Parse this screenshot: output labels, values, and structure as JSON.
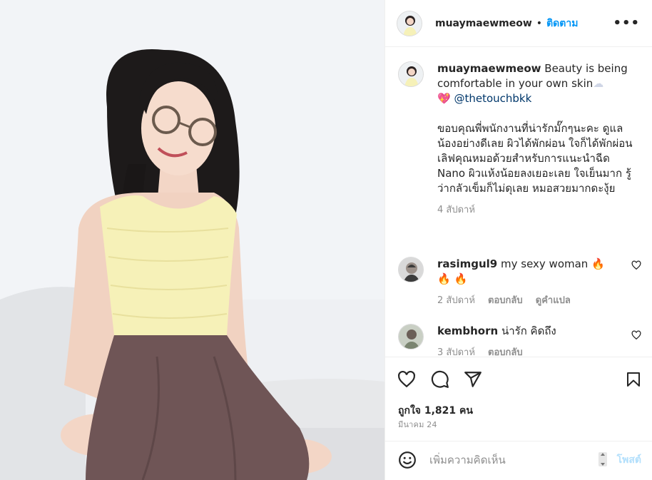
{
  "post": {
    "username": "muaymaewmeow",
    "separator": "•",
    "follow_label": "ติดตาม",
    "more_label": "•••"
  },
  "caption": {
    "username": "muaymaewmeow",
    "line1": "Beauty is being comfortable in your own skin",
    "cloud_emoji": "☁",
    "heart_emoji": "💖",
    "mention": "@thetouchbkk",
    "body": "ขอบคุณพี่พนักงานที่น่ารักมั๊กๆนะคะ ดูแลน้องอย่างดีเลย ผิวได้พักผ่อน ใจก็ได้พักผ่อน เลิฟคุณหมอด้วยสำหรับการแนะนำฉีด Nano ผิวแห้งน้อยลงเยอะเลย ใจเย็นมาก รู้ว่ากลัวเข็มก็ไม่ดุเลย หมอสวยมากดะงุ้ย",
    "time": "4 สัปดาห์"
  },
  "comments": [
    {
      "username": "rasimgul9",
      "text": "my sexy woman",
      "emojis": "🔥 🔥 🔥",
      "time": "2 สัปดาห์",
      "reply_label": "ตอบกลับ",
      "translate_label": "ดูคำแปล"
    },
    {
      "username": "kembhorn",
      "text": "น่ารัก คิดถึง",
      "time": "3 สัปดาห์",
      "reply_label": "ตอบกลับ"
    }
  ],
  "stats": {
    "likes": "ถูกใจ 1,821 คน",
    "date": "มีนาคม 24"
  },
  "add_comment": {
    "placeholder": "เพิ่มความคิดเห็น",
    "post_label": "โพสต์"
  },
  "icons": {
    "like": "heart-icon",
    "comment": "comment-icon",
    "share": "paper-plane-icon",
    "save": "bookmark-icon",
    "emoji": "smiley-icon"
  },
  "colors": {
    "link_blue": "#0095f6",
    "post_disabled": "#b2dffc",
    "muted": "#8e8e8e"
  }
}
